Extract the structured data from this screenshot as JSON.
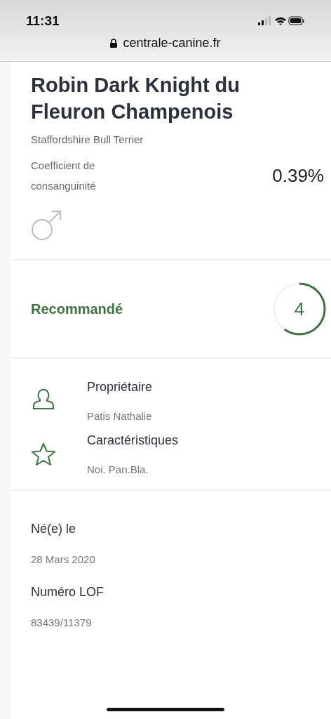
{
  "status_bar": {
    "time": "11:31"
  },
  "browser": {
    "url": "centrale-canine.fr"
  },
  "dog": {
    "name": "Robin Dark Knight du Fleuron Champenois",
    "breed": "Staffordshire Bull Terrier",
    "coefficient_label": "Coefficient de consanguinité",
    "coefficient_value": "0.39%",
    "sex_symbol": {
      "kind": "male"
    }
  },
  "recommendation": {
    "label": "Recommandé",
    "score": "4"
  },
  "info": [
    {
      "kind": "person",
      "label": "Propriétaire",
      "value": "Patis Nathalie"
    },
    {
      "kind": "star",
      "label": "Caractéristiques",
      "value": "Noi. Pan.Bla."
    }
  ],
  "details": [
    {
      "label": "Né(e) le",
      "value": "28 Mars 2020"
    },
    {
      "label": "Numéro LOF",
      "value": "83439/11379"
    }
  ]
}
